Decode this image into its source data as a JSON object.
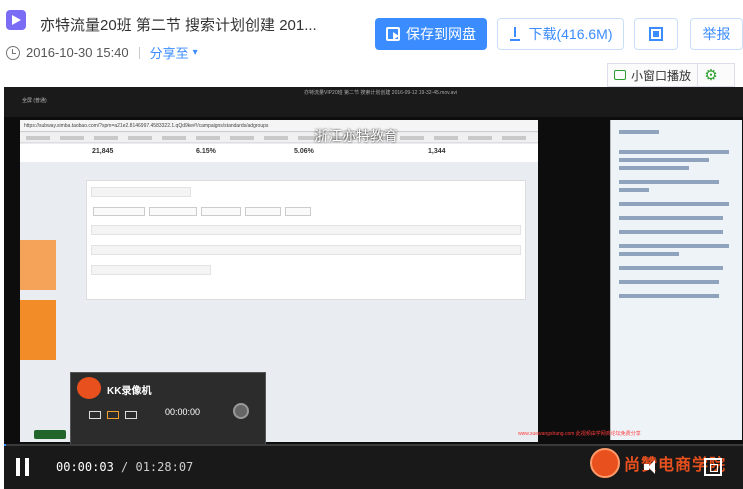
{
  "file": {
    "title": "亦特流量20班 第二节 搜索计划创建 201...",
    "date": "2016-10-30 15:40",
    "share_label": "分享至"
  },
  "actions": {
    "save_label": "保存到网盘",
    "download_label": "下载(416.6M)",
    "report_label": "举报"
  },
  "mini_player": {
    "label": "小窗口播放"
  },
  "video": {
    "watermark": "浙江亦特教育",
    "stats": [
      "21,845",
      "6.15%",
      "5.06%",
      "1,344"
    ],
    "recorder_title": "KK录像机",
    "recorder_time": "00:00:00",
    "ticker": "www.xuewangshang.com 此视频由学网商论坛免费分享",
    "url_text": "https://subway.simba.taobao.com/?spm=a21e2.8146997.4583322.1.qQd9ke#!/campaigns/standards/adgroups",
    "progress_fraction": 0.0
  },
  "player": {
    "current_time": "00:00:03",
    "separator": " / ",
    "duration": "01:28:07",
    "brand_name": "尚赞电商学院"
  },
  "colors": {
    "accent": "#3b8cff",
    "mini_green": "#2ca02c",
    "brand_orange": "#e8501e"
  }
}
